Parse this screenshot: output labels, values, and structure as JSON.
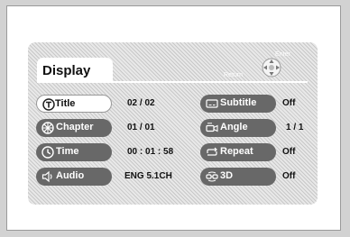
{
  "display_title": "Display",
  "nav": {
    "return_label": "Return",
    "enter_label": "Enter"
  },
  "left_items": [
    {
      "label": "Title",
      "value": "02 / 02",
      "icon": "title-icon"
    },
    {
      "label": "Chapter",
      "value": "01 / 01",
      "icon": "chapter-icon"
    },
    {
      "label": "Time",
      "value": "00 : 01 : 58",
      "icon": "time-icon"
    },
    {
      "label": "Audio",
      "value": "ENG 5.1CH",
      "icon": "audio-icon"
    }
  ],
  "right_items": [
    {
      "label": "Subtitle",
      "value": "Off",
      "icon": "subtitle-icon"
    },
    {
      "label": "Angle",
      "value": "1 / 1",
      "icon": "angle-icon"
    },
    {
      "label": "Repeat",
      "value": "Off",
      "icon": "repeat-icon"
    },
    {
      "label": "3D",
      "value": "Off",
      "icon": "3d-icon"
    }
  ],
  "colors": {
    "pill": "#686868",
    "selected_pill": "#ffffff",
    "panel": "#d9d9d9"
  }
}
